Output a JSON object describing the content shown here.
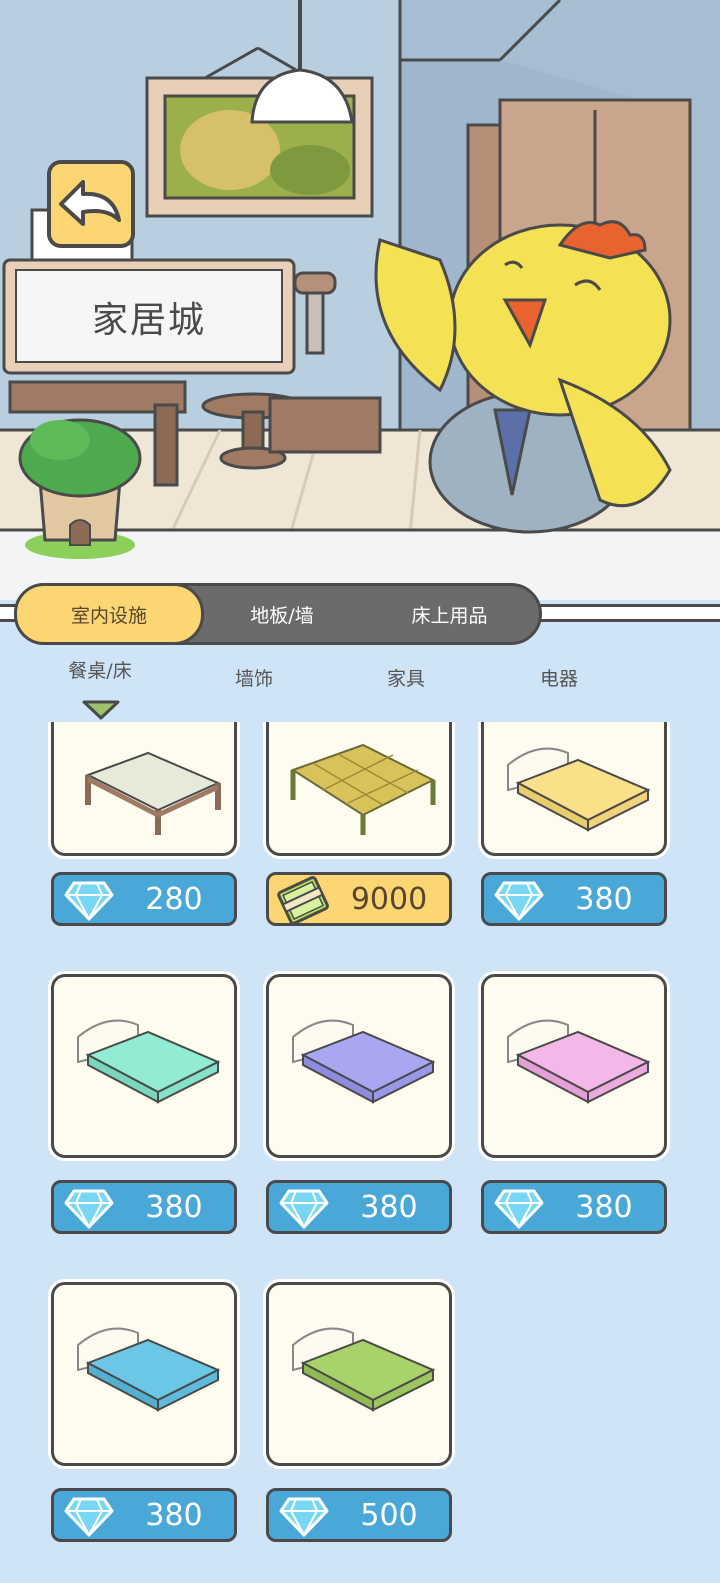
{
  "header": {
    "title": "家居城"
  },
  "tabs": [
    {
      "label": "室内设施",
      "active": true
    },
    {
      "label": "地板/墙",
      "active": false
    },
    {
      "label": "床上用品",
      "active": false
    }
  ],
  "subtabs": [
    {
      "label": "餐桌/床",
      "active": true
    },
    {
      "label": "墙饰",
      "active": false
    },
    {
      "label": "家具",
      "active": false
    },
    {
      "label": "电器",
      "active": false
    }
  ],
  "items": [
    {
      "name": "wooden-bed",
      "price": "280",
      "currency": "gem",
      "color": "#e6ead9"
    },
    {
      "name": "bamboo-bed",
      "price": "9000",
      "currency": "cash",
      "color": "#d9c25a"
    },
    {
      "name": "yellow-bed",
      "price": "380",
      "currency": "gem",
      "color": "#fbe08a"
    },
    {
      "name": "mint-bed",
      "price": "380",
      "currency": "gem",
      "color": "#92ecd3"
    },
    {
      "name": "purple-bed",
      "price": "380",
      "currency": "gem",
      "color": "#a9a6f2"
    },
    {
      "name": "pink-bed",
      "price": "380",
      "currency": "gem",
      "color": "#f3b8e8"
    },
    {
      "name": "blue-bed",
      "price": "380",
      "currency": "gem",
      "color": "#6cc7e6"
    },
    {
      "name": "green-bed",
      "price": "500",
      "currency": "gem",
      "color": "#a9d26a"
    }
  ]
}
